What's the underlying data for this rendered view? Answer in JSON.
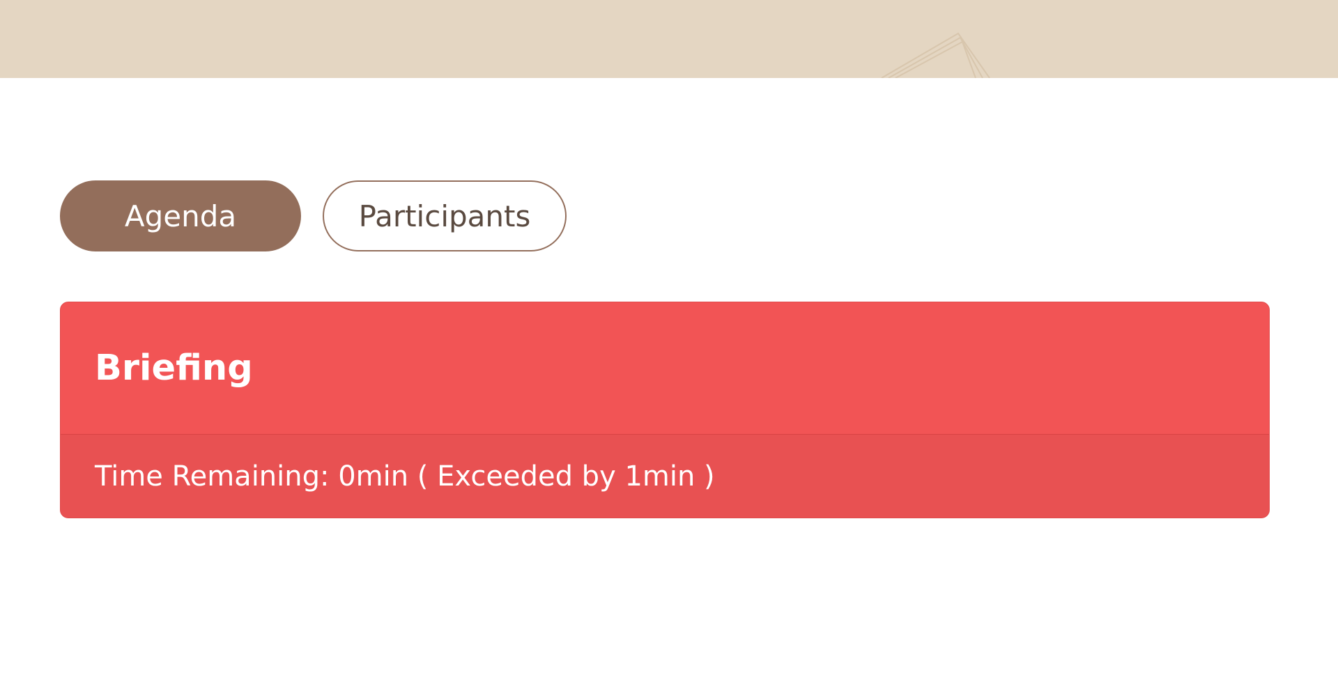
{
  "colors": {
    "header_band": "#e4d6c2",
    "tab_active_bg": "#936e5b",
    "card_bg": "#f25455",
    "card_footer_bg": "#e85152"
  },
  "tabs": [
    {
      "label": "Agenda",
      "active": true
    },
    {
      "label": "Participants",
      "active": false
    }
  ],
  "agenda_item": {
    "title": "Briefing",
    "time_text": "Time Remaining: 0min ( Exceeded by 1min )"
  }
}
